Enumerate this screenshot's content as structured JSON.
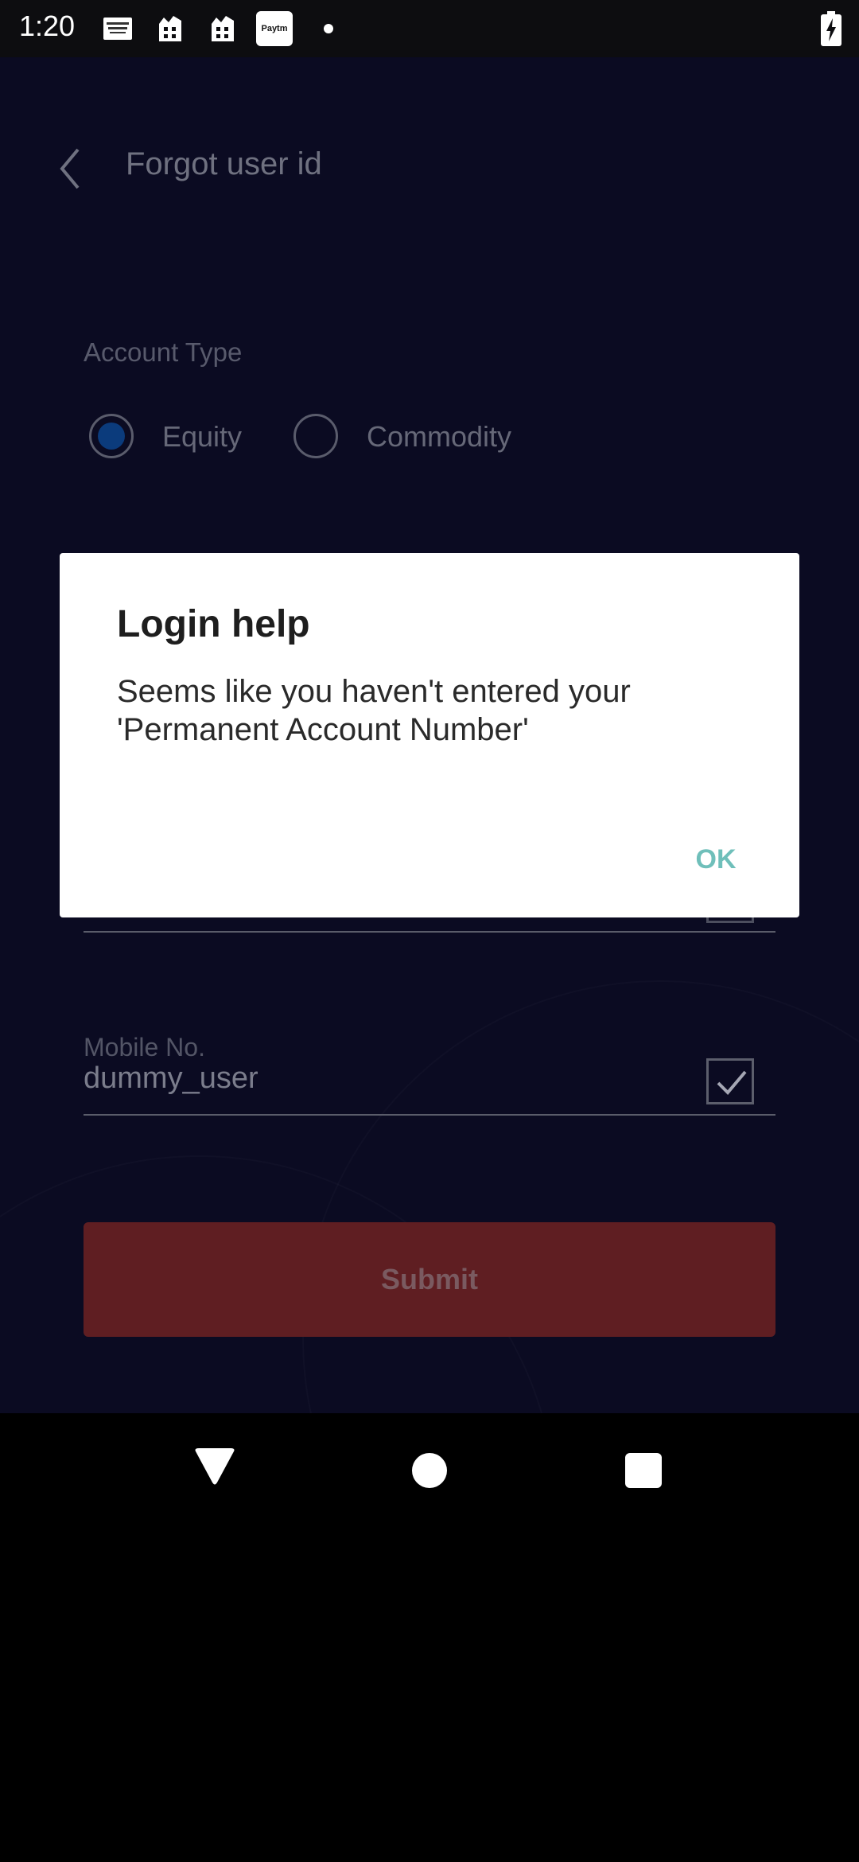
{
  "status_bar": {
    "time": "1:20",
    "notification_icons": [
      "farm-bureau-icon",
      "app-icon",
      "app-icon",
      "paytm-icon",
      "dot-icon"
    ],
    "paytm_label": "Paytm",
    "battery": "battery-charging-icon"
  },
  "header": {
    "back_icon": "chevron-left-icon",
    "title": "Forgot user id"
  },
  "form": {
    "account_type_label": "Account Type",
    "options": [
      {
        "label": "Equity",
        "selected": true
      },
      {
        "label": "Commodity",
        "selected": false
      }
    ],
    "mobile": {
      "label": "Mobile No.",
      "value": "dummy_user",
      "verified": true
    },
    "submit_label": "Submit"
  },
  "dialog": {
    "title": "Login help",
    "message": "Seems like you haven't entered your 'Permanent Account Number'",
    "ok_label": "OK"
  },
  "colors": {
    "background": "#0b0b22",
    "submit": "#5f1e22",
    "accent": "#6fbfba",
    "radio_selected": "#0b3b7c"
  },
  "nav_bar": {
    "icons": [
      "back-triangle-icon",
      "home-circle-icon",
      "recents-square-icon"
    ]
  }
}
